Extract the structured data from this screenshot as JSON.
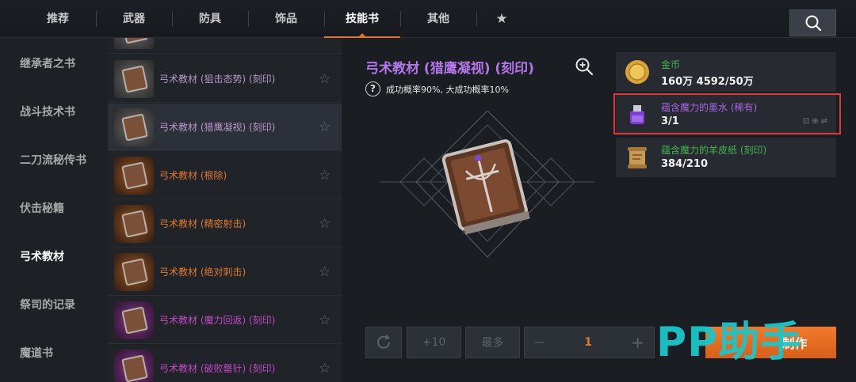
{
  "tabs": [
    {
      "label": "推荐"
    },
    {
      "label": "武器"
    },
    {
      "label": "防具"
    },
    {
      "label": "饰品"
    },
    {
      "label": "技能书",
      "active": true
    },
    {
      "label": "其他"
    }
  ],
  "tab_extra_icon": "star-icon",
  "search_icon": "search-icon",
  "categories": [
    {
      "label": "继承者之书"
    },
    {
      "label": "战斗技术书"
    },
    {
      "label": "二刀流秘传书"
    },
    {
      "label": "伏击秘籍"
    },
    {
      "label": "弓术教材",
      "active": true
    },
    {
      "label": "祭司的记录"
    },
    {
      "label": "魔道书"
    }
  ],
  "items": [
    {
      "name": "弓术教材 (狙击态势) (刻印)",
      "grade": "gray"
    },
    {
      "name": "弓术教材 (猎鹰凝视) (刻印)",
      "grade": "gray",
      "selected": true
    },
    {
      "name": "弓术教材 (根除)",
      "grade": "orange"
    },
    {
      "name": "弓术教材 (精密射击)",
      "grade": "orange"
    },
    {
      "name": "弓术教材 (绝对刺击)",
      "grade": "orange"
    },
    {
      "name": "弓术教材 (魔力回返) (刻印)",
      "grade": "purple"
    },
    {
      "name": "弓术教材 (破败罄针) (刻印)",
      "grade": "purple"
    }
  ],
  "detail": {
    "title": "弓术教材 (猎鹰凝视) (刻印)",
    "rate_text": "成功概率90%, 大成功概率10%",
    "help_icon": "?"
  },
  "materials": [
    {
      "name": "金币",
      "value": "160万 4592/50万",
      "color": "green",
      "icon": "gold-coin-icon"
    },
    {
      "name": "蕴含魔力的墨水 (稀有)",
      "value": "3/1",
      "color": "purple",
      "icon": "ink-bottle-icon",
      "highlighted": true
    },
    {
      "name": "蕴含魔力的羊皮纸 (刻印)",
      "value": "384/210",
      "color": "green",
      "icon": "parchment-icon"
    }
  ],
  "controls": {
    "plus10": "+10",
    "max": "最多",
    "minus": "—",
    "quantity": "1",
    "plus": "+",
    "make": "制作"
  },
  "watermark": "PP助手",
  "colors": {
    "accent": "#e3742b",
    "title_purple": "#b277ea",
    "highlight_red": "#e3383b",
    "watermark": "#19c7c9"
  }
}
